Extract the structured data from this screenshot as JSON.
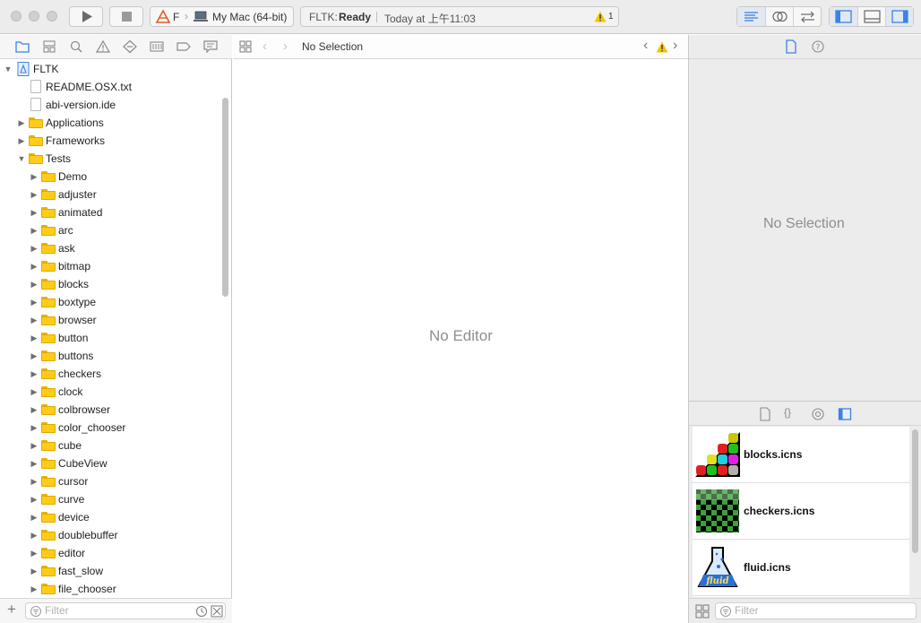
{
  "toolbar": {
    "scheme_name": "F",
    "destination": "My Mac (64-bit)",
    "activity_project": "FLTK: ",
    "activity_status": "Ready",
    "activity_time": "Today at 上午11:03",
    "warning_count": "1"
  },
  "navigator": {
    "root": "FLTK",
    "top_files": [
      "README.OSX.txt",
      "abi-version.ide"
    ],
    "groups": [
      "Applications",
      "Frameworks",
      "Tests"
    ],
    "test_folders": [
      "Demo",
      "adjuster",
      "animated",
      "arc",
      "ask",
      "bitmap",
      "blocks",
      "boxtype",
      "browser",
      "button",
      "buttons",
      "checkers",
      "clock",
      "colbrowser",
      "color_chooser",
      "cube",
      "CubeView",
      "cursor",
      "curve",
      "device",
      "doublebuffer",
      "editor",
      "fast_slow",
      "file_chooser"
    ],
    "filter_placeholder": "Filter"
  },
  "editor": {
    "jumpbar_title": "No Selection",
    "empty_message": "No Editor"
  },
  "inspector": {
    "empty_message": "No Selection",
    "library_items": [
      "blocks.icns",
      "checkers.icns",
      "fluid.icns"
    ],
    "filter_placeholder": "Filter"
  },
  "colors": {
    "accent": "#3b82e6",
    "folder": "#ffcc1a",
    "warning": "#f5c400"
  }
}
